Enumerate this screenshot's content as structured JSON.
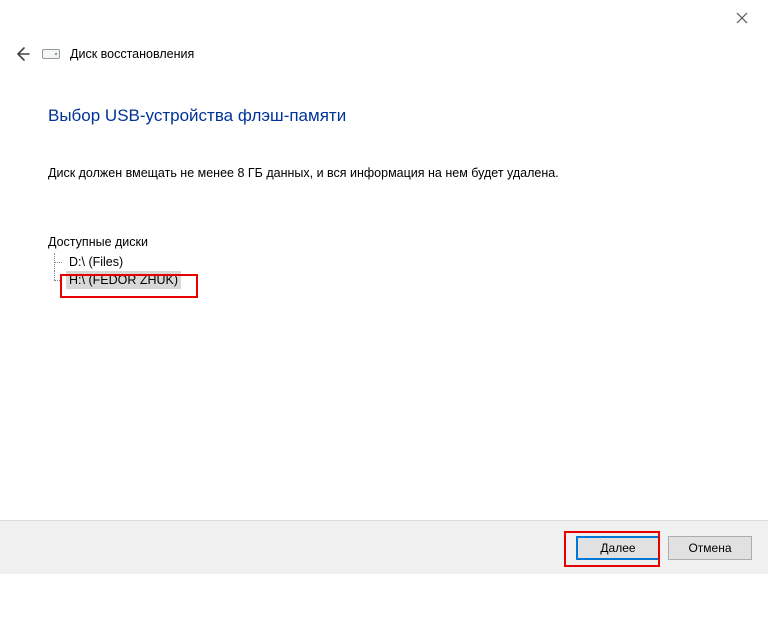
{
  "header": {
    "title": "Диск восстановления"
  },
  "page": {
    "title": "Выбор USB-устройства флэш-памяти",
    "instruction": "Диск должен вмещать не менее 8 ГБ данных, и вся информация на нем будет удалена."
  },
  "drives": {
    "label": "Доступные диски",
    "items": [
      {
        "label": "D:\\ (Files)",
        "selected": false
      },
      {
        "label": "H:\\ (FEDOR ZHUK)",
        "selected": true
      }
    ]
  },
  "footer": {
    "next": "Далее",
    "cancel": "Отмена"
  }
}
